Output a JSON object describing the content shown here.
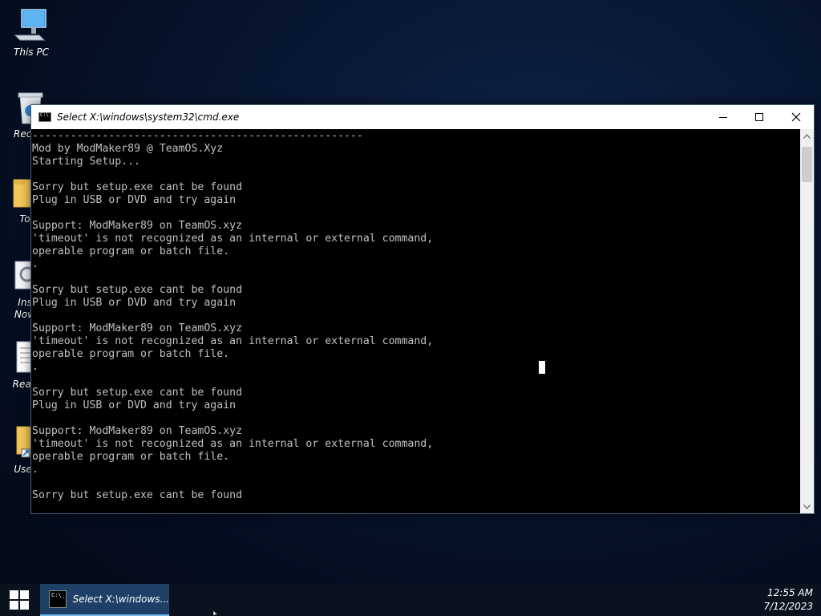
{
  "desktop": {
    "icons": [
      {
        "label": "This PC",
        "icon": "this-pc-icon"
      },
      {
        "label": "Recyc",
        "icon": "recycle-bin-icon"
      },
      {
        "label": "To",
        "icon": "folder-icon"
      },
      {
        "label": "Ins\nNow",
        "icon": "installer-icon"
      },
      {
        "label": "Read",
        "icon": "document-icon"
      },
      {
        "label": "User",
        "icon": "folder-shortcut-icon"
      }
    ]
  },
  "window": {
    "title": "Select X:\\windows\\system32\\cmd.exe",
    "console_lines": [
      "----------------------------------------------------",
      "Mod by ModMaker89 @ TeamOS.Xyz",
      "Starting Setup...",
      "",
      "Sorry but setup.exe cant be found",
      "Plug in USB or DVD and try again",
      "",
      "Support: ModMaker89 on TeamOS.xyz",
      "'timeout' is not recognized as an internal or external command,",
      "operable program or batch file.",
      ".",
      "",
      "Sorry but setup.exe cant be found",
      "Plug in USB or DVD and try again",
      "",
      "Support: ModMaker89 on TeamOS.xyz",
      "'timeout' is not recognized as an internal or external command,",
      "operable program or batch file.",
      ".",
      "",
      "Sorry but setup.exe cant be found",
      "Plug in USB or DVD and try again",
      "",
      "Support: ModMaker89 on TeamOS.xyz",
      "'timeout' is not recognized as an internal or external command,",
      "operable program or batch file.",
      ".",
      "",
      "Sorry but setup.exe cant be found"
    ]
  },
  "taskbar": {
    "start_icon": "windows-logo-icon",
    "task_label": "Select X:\\windows...",
    "time": "12:55 AM",
    "date": "7/12/2023"
  },
  "colors": {
    "console_bg": "#000000",
    "console_text": "#c0c0c0",
    "taskbar_active": "#1e3f66"
  }
}
